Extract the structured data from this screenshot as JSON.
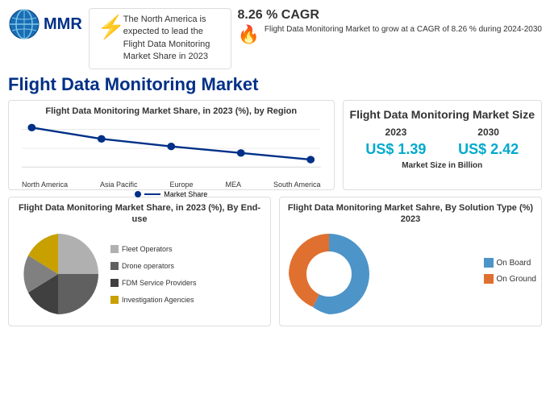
{
  "logo": {
    "text": "MMR"
  },
  "info_box": {
    "text": "The North America is expected to lead the Flight Data Monitoring Market Share in 2023"
  },
  "cagr": {
    "value": "8.26 % CAGR",
    "description": "Flight Data Monitoring Market to grow at a CAGR of 8.26 % during 2024-2030"
  },
  "main_title": "Flight Data Monitoring Market",
  "line_chart": {
    "title": "Flight Data Monitoring Market Share, in 2023 (%), by Region",
    "legend": "Market Share",
    "x_labels": [
      "North America",
      "Asia Pacific",
      "Europe",
      "MEA",
      "South America"
    ]
  },
  "market_size": {
    "title": "Flight Data Monitoring Market Size",
    "year_2023": "2023",
    "year_2030": "2030",
    "value_2023": "US$ 1.39",
    "value_2030": "US$ 2.42",
    "label": "Market Size in Billion"
  },
  "pie_chart": {
    "title": "Flight Data Monitoring Market Share, in 2023 (%), By End-use",
    "legend": [
      {
        "label": "Fleet Operators",
        "color": "#b0b0b0"
      },
      {
        "label": "Drone operators",
        "color": "#606060"
      },
      {
        "label": "FDM Service Providers",
        "color": "#404040"
      },
      {
        "label": "Investigation Agencies",
        "color": "#c8a000"
      }
    ]
  },
  "donut_chart": {
    "title": "Flight Data Monitoring Market Sahre, By Solution Type (%) 2023",
    "legend": [
      {
        "label": "On Board",
        "color": "#4d94c9"
      },
      {
        "label": "On Ground",
        "color": "#e07030"
      }
    ]
  }
}
